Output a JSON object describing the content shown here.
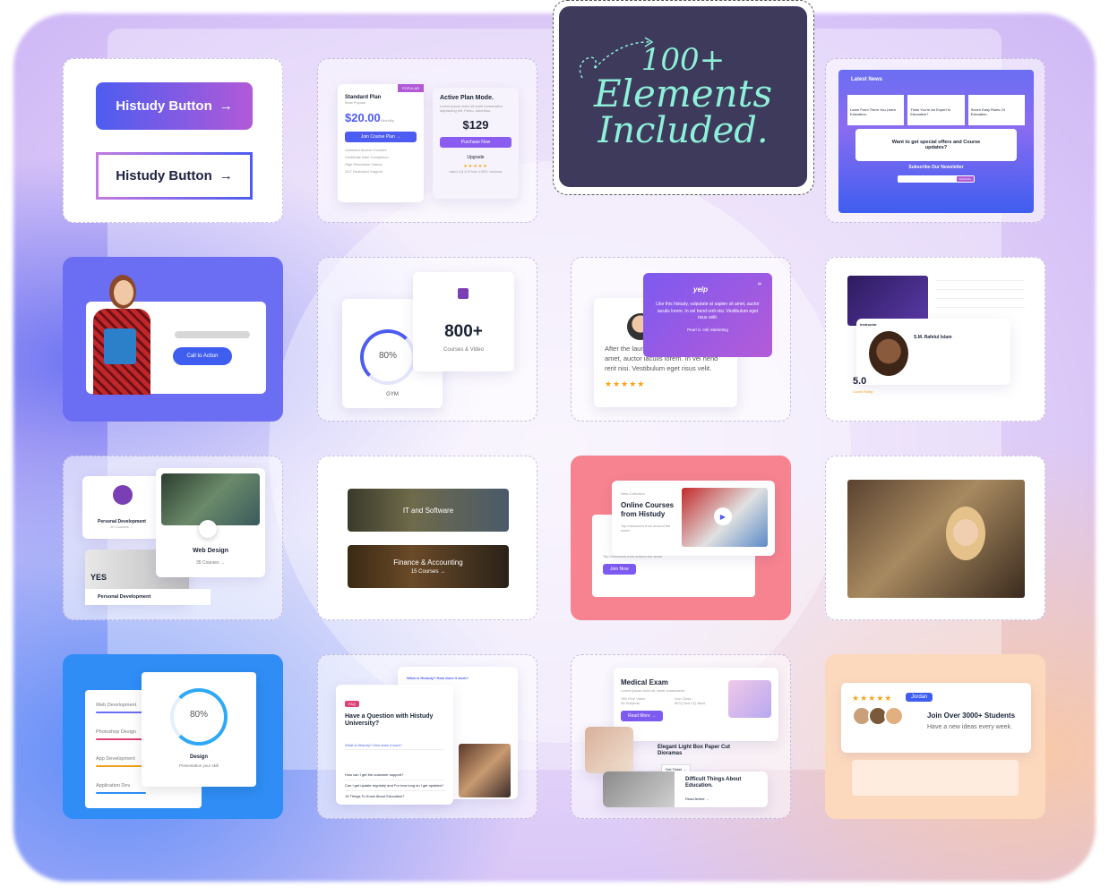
{
  "feature": {
    "line1": "100+",
    "line2": "Elements",
    "line3": "Included."
  },
  "buttons": {
    "primary": "Histudy Button",
    "outline": "Histudy Button",
    "arrow": "→"
  },
  "pricing": {
    "badge": "POPULAR",
    "standard_name": "Standard Plan",
    "standard_sub": "Most Popular",
    "standard_price": "$20.00",
    "standard_period": "/Monthly",
    "standard_cta": "Join Course Plan →",
    "features": [
      "Unlimited Access Courses",
      "Certificate After Completion",
      "High Resolution Videos",
      "24/7 Dedicated Support"
    ],
    "active_title": "Active Plan Mode.",
    "active_desc": "Lorem ipsum dolor sit amet consectetur adipisicing elit. Fierro, doloribus.",
    "active_price": "$129",
    "active_cta": "Purchase Now",
    "upgrade": "Upgrade",
    "rating_note": "rated 4.8 & 5 from 1000+ reviews"
  },
  "news": {
    "title": "Latest News",
    "posts": [
      "Learn From Them You Learn Education.",
      "Think You're An Expert In Education?",
      "Seven Easy Rules Of Education."
    ],
    "newsletter_q": "Want to get special offers and Course updates?",
    "newsletter_title": "Subscribe Our Newsletter",
    "subscribe": "Subscribe"
  },
  "cta": {
    "button": "Call to Action"
  },
  "stats": {
    "ring_value": "80%",
    "ring_label": "GYM",
    "count": "800+",
    "count_label": "Courses & Video"
  },
  "testimonial": {
    "brand": "yelp",
    "quote_main": "Like this histudy, vulputate at sapien sit amet, auctor iaculis lorem. In vel hend rerit nisi. Vestibulum eget risus velit.",
    "author": "Pearl S. Hill, Marketing",
    "back_text": "After the launch, vulputate at sapien sit amet, auctor iaculis lorem. In vel hend rerit nisi. Vestibulum eget risus velit."
  },
  "instructor": {
    "label": "Instructor",
    "name": "S.M. Rafelul Islam",
    "rating": "5.0",
    "rating_label": "Course Rating",
    "review": "Review"
  },
  "categories": {
    "cat1_name": "Personal Development",
    "cat1_count": "20 Courses →",
    "cat2_name": "Web Design",
    "cat2_count": "35 Courses →",
    "cat3_name": "Personal Development",
    "cat3_yes": "YES"
  },
  "banners": {
    "b1": "IT and Software",
    "b2_title": "Finance & Accounting",
    "b2_count": "15 Courses →"
  },
  "online": {
    "tag": "New Collection",
    "title": "Online Courses from Histudy",
    "sub": "Top instructors from around the world",
    "back_sub": "Top instructors from around the world",
    "join": "Join Now"
  },
  "progress": {
    "items": [
      "Web Development",
      "Photoshop Design",
      "App Development",
      "Application Dev"
    ],
    "value": "80%",
    "label": "Design",
    "sub": "Presentation your skill"
  },
  "faq": {
    "tag": "FAQ",
    "title": "Have a Question with Histudy University?",
    "q1": "What is Histudy? How does it work?",
    "questions": [
      "How can I get the customer support?",
      "Can I get update regularly and For how long do I get updates?",
      "15 Things To Know About Education?"
    ],
    "top_q": "What is Histudy? How does it work?"
  },
  "exam": {
    "title": "Medical Exam",
    "desc": "Lorem ipsum dolor sit, amet consectetur.",
    "meta": [
      "785 Free Video",
      "Live Class",
      "95 Subjects",
      "MCQ and CQ Bank"
    ],
    "read": "Read More →",
    "article1": "Elegant Light Box Paper Cut Dioramas",
    "get_ticket": "Get Ticket →",
    "article2": "Difficult Things About Education.",
    "read_article": "Read Article →"
  },
  "join": {
    "tag": "Jordan",
    "title": "Join Over 3000+ Students",
    "sub": "Have a new ideas every week."
  }
}
